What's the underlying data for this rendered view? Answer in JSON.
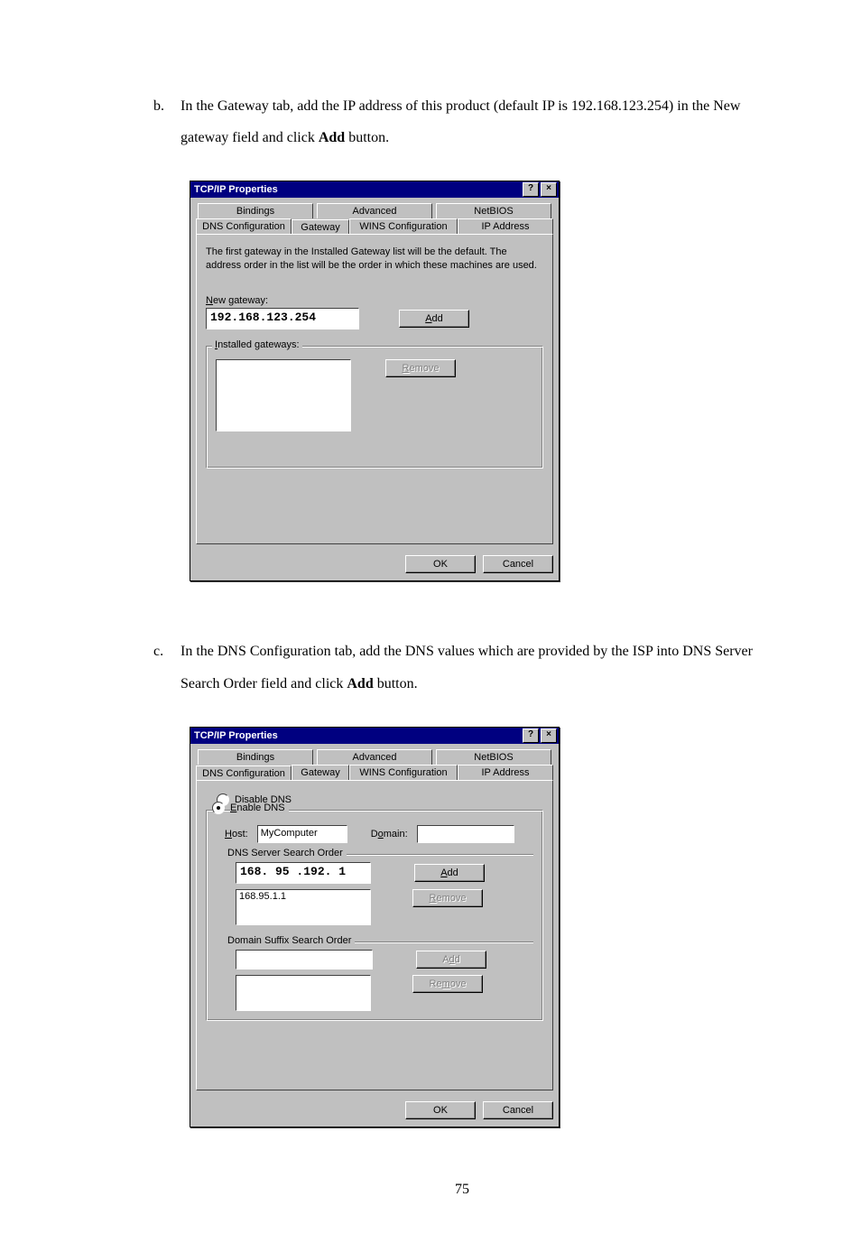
{
  "instructions": {
    "b": {
      "marker": "b.",
      "text_before": "In the Gateway tab, add the IP address of this product (default IP is 192.168.123.254) in the New gateway field and click ",
      "bold": "Add",
      "text_after": " button."
    },
    "c": {
      "marker": "c.",
      "text_before": "In the DNS Configuration tab, add the DNS values which are provided by the ISP into DNS Server Search Order field and click ",
      "bold": "Add",
      "text_after": " button."
    }
  },
  "dialog1": {
    "title": "TCP/IP Properties",
    "help_btn": "?",
    "close_btn": "×",
    "tabs_back": [
      "Bindings",
      "Advanced",
      "NetBIOS"
    ],
    "tabs_front": [
      "DNS Configuration",
      "Gateway",
      "WINS Configuration",
      "IP Address"
    ],
    "desc": "The first gateway in the Installed Gateway list will be the default. The address order in the list will be the order in which these machines are used.",
    "new_gateway_label_pre": "N",
    "new_gateway_label_post": "ew gateway:",
    "new_gateway_value": "192.168.123.254",
    "add_btn_acc": "A",
    "add_btn_post": "dd",
    "installed_label_pre": "I",
    "installed_label_post": "nstalled gateways:",
    "remove_btn_pre": "",
    "remove_btn_acc": "R",
    "remove_btn_post": "emove",
    "ok": "OK",
    "cancel": "Cancel"
  },
  "dialog2": {
    "title": "TCP/IP Properties",
    "help_btn": "?",
    "close_btn": "×",
    "tabs_back": [
      "Bindings",
      "Advanced",
      "NetBIOS"
    ],
    "tabs_front": [
      "DNS Configuration",
      "Gateway",
      "WINS Configuration",
      "IP Address"
    ],
    "disable_dns_pre": "D",
    "disable_dns_mid": "i",
    "disable_dns_post": "sable DNS",
    "enable_dns_pre": "",
    "enable_dns_acc": "E",
    "enable_dns_post": "nable DNS",
    "host_label_acc": "H",
    "host_label_post": "ost:",
    "host_value": "MyComputer",
    "domain_label_pre": "D",
    "domain_label_acc": "o",
    "domain_label_post": "main:",
    "domain_value": "",
    "dns_search_label": "DNS Server Search Order",
    "dns_input_value": "168. 95 .192. 1",
    "dns_list_item": "168.95.1.1",
    "domain_suffix_label": "Domain Suffix Search Order",
    "suffix_input_value": "",
    "add_acc": "A",
    "add_post": "dd",
    "remove_acc": "R",
    "remove_post": "emove",
    "add2_pre": "A",
    "add2_acc": "d",
    "add2_post": "d",
    "remove2_pre": "Re",
    "remove2_acc": "m",
    "remove2_post": "ove",
    "ok": "OK",
    "cancel": "Cancel"
  },
  "page_number": "75"
}
